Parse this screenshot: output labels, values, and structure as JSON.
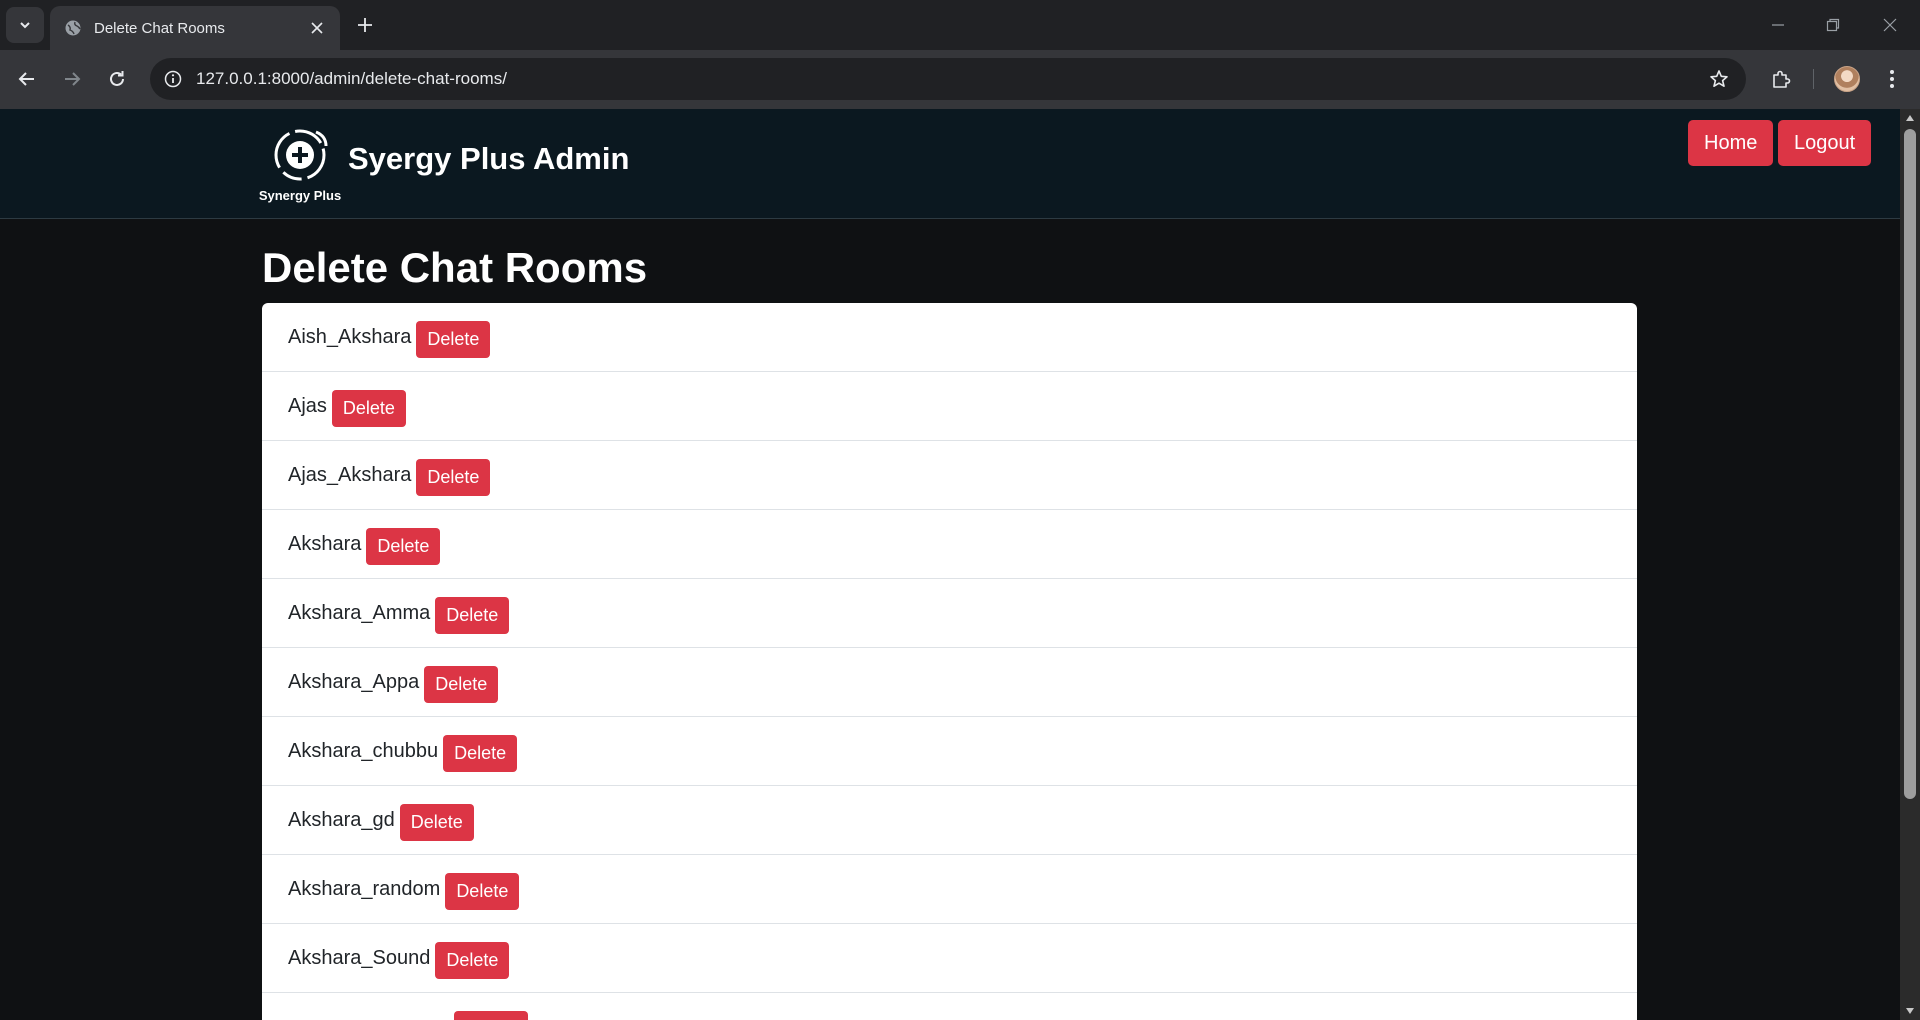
{
  "browser": {
    "tab_title": "Delete Chat Rooms",
    "url": "127.0.0.1:8000/admin/delete-chat-rooms/"
  },
  "header": {
    "logo_caption": "Synergy Plus",
    "site_title": "Syergy Plus Admin",
    "home_label": "Home",
    "logout_label": "Logout"
  },
  "page": {
    "title": "Delete Chat Rooms",
    "delete_label": "Delete"
  },
  "rooms": [
    "Aish_Akshara",
    "Ajas",
    "Ajas_Akshara",
    "Akshara",
    "Akshara_Amma",
    "Akshara_Appa",
    "Akshara_chubbu",
    "Akshara_gd",
    "Akshara_random",
    "Akshara_Sound",
    ""
  ],
  "colors": {
    "danger": "#dc3545",
    "header_bg": "#0b1820",
    "page_bg": "#0f1113"
  }
}
